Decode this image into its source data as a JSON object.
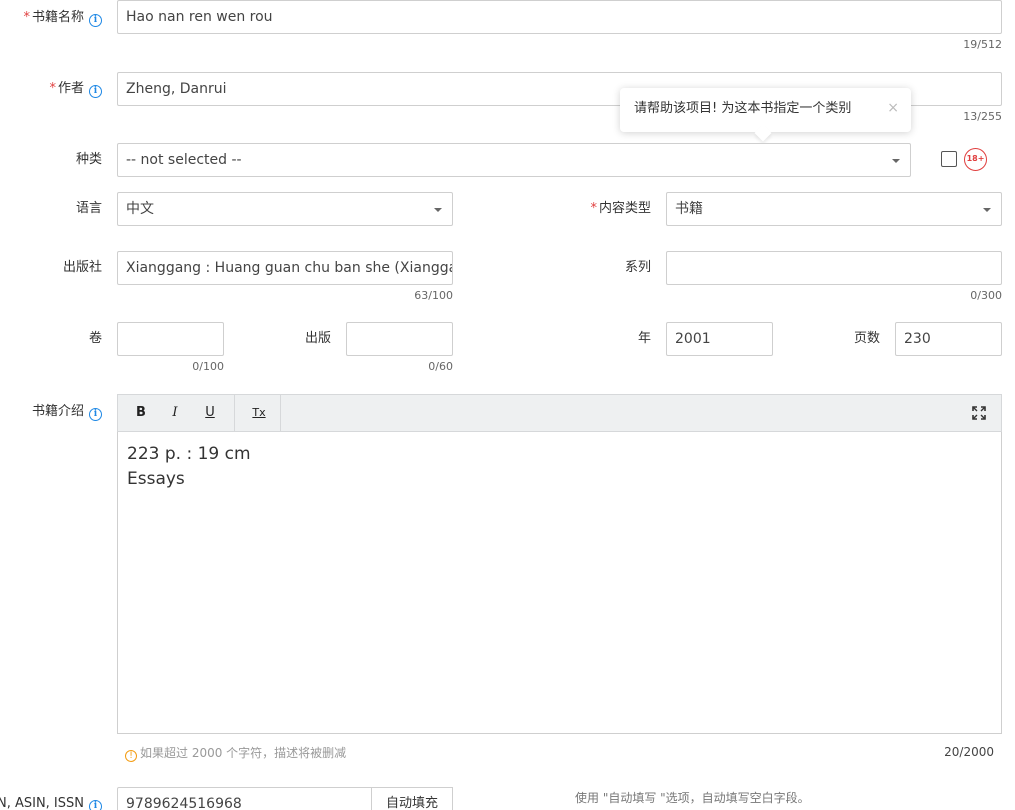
{
  "title": {
    "label": "书籍名称",
    "value": "Hao nan ren wen rou",
    "counter": "19/512"
  },
  "author": {
    "label": "作者",
    "value": "Zheng, Danrui",
    "counter": "13/255"
  },
  "tooltip": {
    "text": "请帮助该项目! 为这本书指定一个类别",
    "close": "×"
  },
  "category": {
    "label": "种类",
    "value": "-- not selected --",
    "adult_badge": "18+"
  },
  "language": {
    "label": "语言",
    "value": "中文"
  },
  "content_type": {
    "label": "内容类型",
    "value": "书籍"
  },
  "publisher": {
    "label": "出版社",
    "value": "Xianggang : Huang guan chu ban she (Xianggang) you xian gong si",
    "counter": "63/100"
  },
  "series": {
    "label": "系列",
    "value": "",
    "counter": "0/300"
  },
  "volume": {
    "label": "卷",
    "value": "",
    "counter": "0/100"
  },
  "edition": {
    "label": "出版",
    "value": "",
    "counter": "0/60"
  },
  "year": {
    "label": "年",
    "value": "2001"
  },
  "pages": {
    "label": "页数",
    "value": "230"
  },
  "description": {
    "label": "书籍介绍",
    "toolbar": {
      "bold": "B",
      "italic": "I",
      "underline": "U",
      "clear": "Tx"
    },
    "lines": [
      "223 p. : 19 cm",
      "Essays"
    ],
    "warning": "如果超过 2000 个字符，描述将被删减",
    "counter": "20/2000"
  },
  "isbn": {
    "label": "ISBN, ASIN, ISSN",
    "value": "9789624516968",
    "autofill_button": "自动填充",
    "hint": "使用 \"自动填写 \"选项，自动填写空白字段。"
  }
}
